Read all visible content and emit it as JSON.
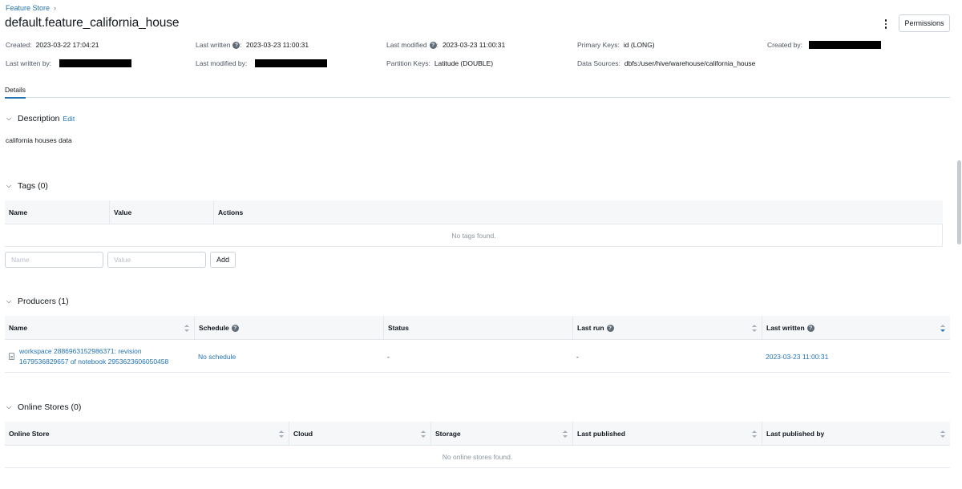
{
  "breadcrumb": {
    "root": "Feature Store",
    "separator": "›"
  },
  "title": "default.feature_california_house",
  "header_actions": {
    "permissions_label": "Permissions"
  },
  "metadata": {
    "created_label": "Created:",
    "created_value": "2023-03-22 17:04:21",
    "last_written_label": "Last written",
    "last_written_value": "2023-03-23 11:00:31",
    "last_modified_label": "Last modified",
    "last_modified_value": "2023-03-23 11:00:31",
    "primary_keys_label": "Primary Keys:",
    "primary_keys_value": "id (LONG)",
    "created_by_label": "Created by:",
    "last_written_by_label": "Last written by:",
    "last_modified_by_label": "Last modified by:",
    "partition_keys_label": "Partition Keys:",
    "partition_keys_value": "Latitude (DOUBLE)",
    "data_sources_label": "Data Sources:",
    "data_sources_value": "dbfs:/user/hive/warehouse/california_house",
    "colon": ":"
  },
  "tabs": {
    "details": "Details"
  },
  "description": {
    "heading": "Description",
    "edit_label": "Edit",
    "text": "california houses data"
  },
  "tags": {
    "heading": "Tags (0)",
    "columns": [
      "Name",
      "Value",
      "Actions"
    ],
    "empty_text": "No tags found.",
    "name_placeholder": "Name",
    "value_placeholder": "Value",
    "add_label": "Add"
  },
  "producers": {
    "heading": "Producers (1)",
    "columns": [
      "Name",
      "Schedule",
      "Status",
      "Last run",
      "Last written"
    ],
    "rows": [
      {
        "name_line1": "workspace 2886963152986371: revision",
        "name_line2": "1679536829657 of notebook 2953623606050458",
        "schedule": "No schedule",
        "status": "-",
        "last_run": "-",
        "last_written": "2023-03-23 11:00:31"
      }
    ]
  },
  "online_stores": {
    "heading": "Online Stores (0)",
    "columns": [
      "Online Store",
      "Cloud",
      "Storage",
      "Last published",
      "Last published by"
    ],
    "empty_text": "No online stores found."
  },
  "colors": {
    "link": "#2272b4",
    "header_bg": "#f6f7f9",
    "text": "#11171c"
  }
}
